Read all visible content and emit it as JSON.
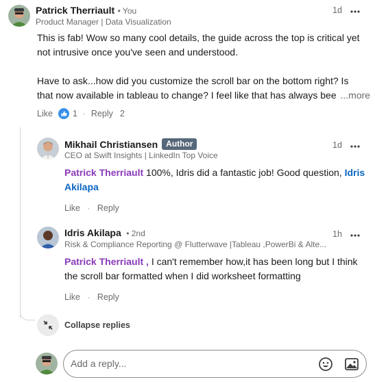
{
  "comment": {
    "author": "Patrick Therriault",
    "you_tag": "• You",
    "headline": "Product Manager | Data Visualization",
    "time": "1d",
    "more_icon": "more-horizontal-icon",
    "paragraph1_line1": "This is fab! Wow so many cool details, the guide across the top is critical yet",
    "paragraph1_line2": "not intrusive once you've seen and understood.",
    "paragraph2_line1": "Have to ask...how did you customize the scroll bar on the bottom right? Is",
    "paragraph2_line2": "that now available in tableau to change? I feel like that has always bee",
    "see_more": "...more",
    "like_label": "Like",
    "reaction_icon": "like-reaction-icon",
    "like_count": "1",
    "reply_label": "Reply",
    "reply_count": "2"
  },
  "replies": [
    {
      "author": "Mikhail Christiansen",
      "badge": "Author",
      "headline": "CEO at Swift Insights | LinkedIn Top Voice",
      "time": "1d",
      "mention": "Patrick Therriault",
      "text_a": " 100%, Idris did a fantastic job! Good question, ",
      "mention2_a": "Idris",
      "mention2_b": "Akilapa",
      "like_label": "Like",
      "reply_label": "Reply"
    },
    {
      "author": "Idris Akilapa",
      "degree": "• 2nd",
      "headline": "Risk & Compliance Reporting @ Flutterwave |Tableau ,PowerBi & Alte...",
      "time": "1h",
      "mention": "Patrick Therriault ,",
      "text_a": " I can't remember how,it has been long but I think",
      "text_b": "the scroll bar formatted when I did worksheet formatting",
      "like_label": "Like",
      "reply_label": "Reply"
    }
  ],
  "collapse_label": "Collapse replies",
  "reply_box": {
    "placeholder": "Add a reply...",
    "emoji_icon": "emoji-icon",
    "image_icon": "image-icon"
  },
  "colors": {
    "mention_purple": "#8a3ab9",
    "mention_blue": "#0a66c2",
    "badge_bg": "#56687a",
    "reaction_blue": "#378fe9"
  }
}
